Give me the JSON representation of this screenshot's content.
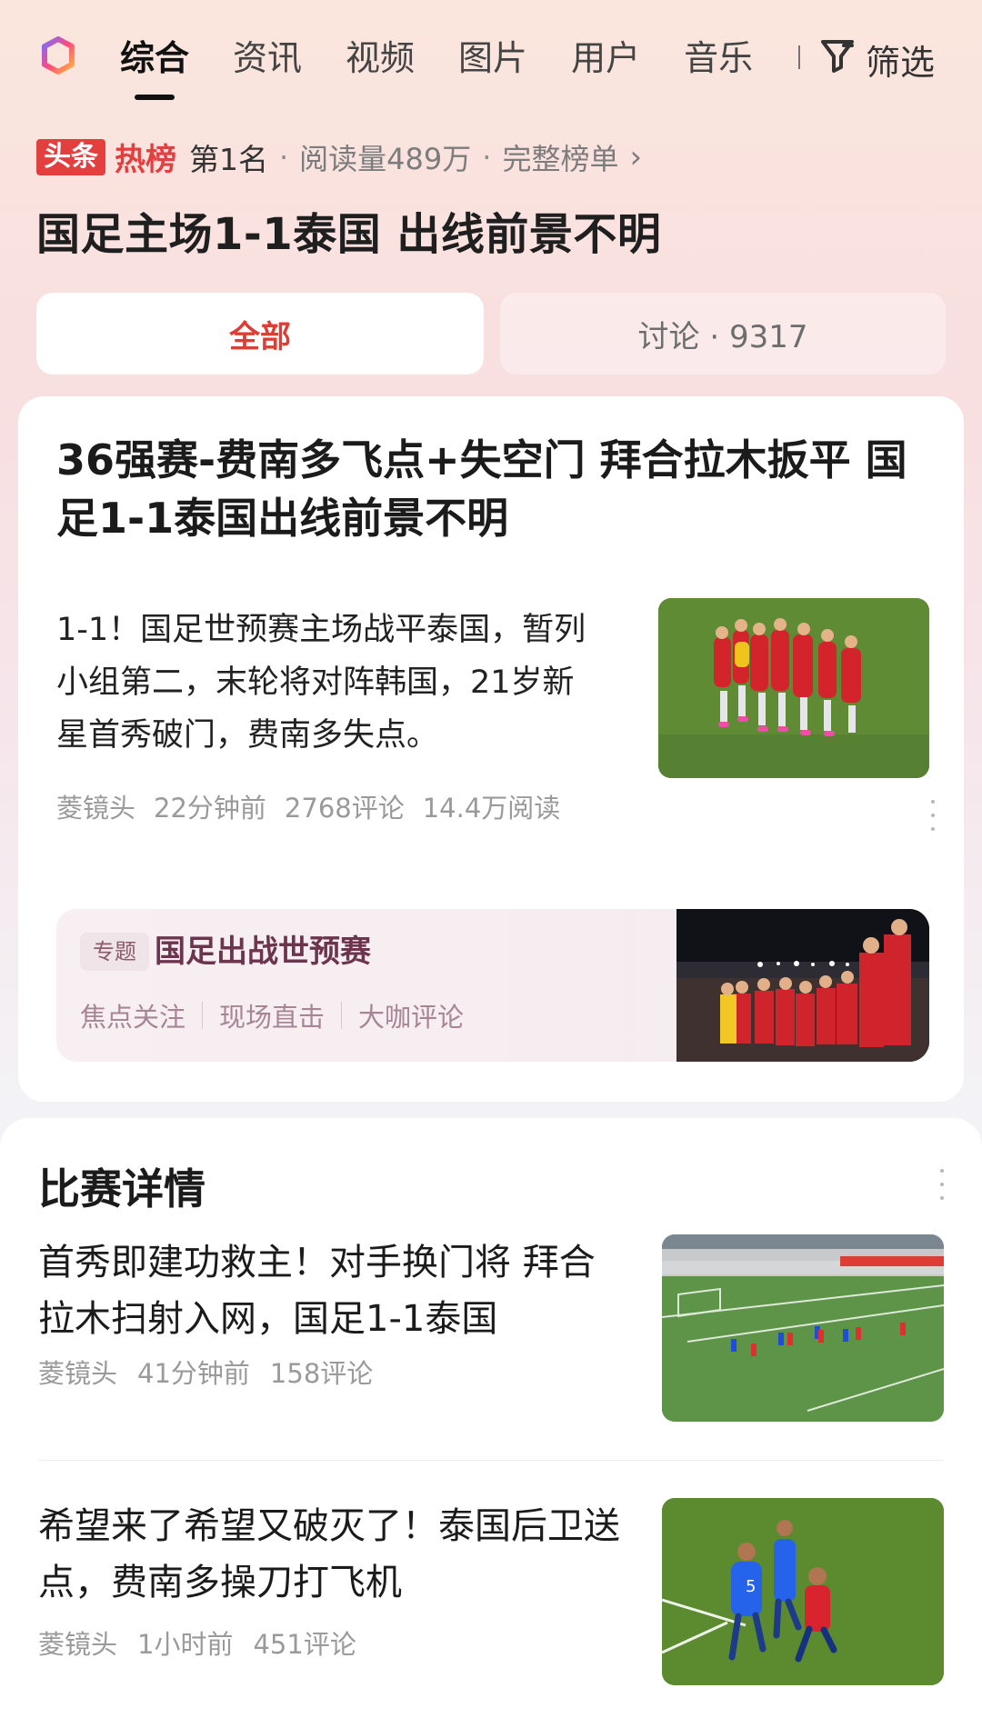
{
  "nav": {
    "tabs": [
      "综合",
      "资讯",
      "视频",
      "图片",
      "用户",
      "音乐"
    ],
    "filter_label": "筛选",
    "filter_icon": "filter-icon",
    "logo_icon": "app-logo-icon"
  },
  "hot": {
    "source_tag": "头条",
    "board_label": "热榜",
    "rank": "第1名",
    "reads": "阅读量489万",
    "full_list": "完整榜单",
    "chevron_icon": "chevron-right-icon"
  },
  "headline": "国足主场1-1泰国 出线前景不明",
  "segments": {
    "all": "全部",
    "discuss": "讨论 · 9317"
  },
  "main_card": {
    "title": "36强赛-费南多飞点+失空门 拜合拉木扳平 国足1-1泰国出线前景不明",
    "summary": "1-1！国足世预赛主场战平泰国，暂列小组第二，末轮将对阵韩国，21岁新星首秀破门，费南多失点。",
    "meta": [
      "菱镜头",
      "22分钟前",
      "2768评论",
      "14.4万阅读"
    ],
    "menu_icon": "more-vertical-icon",
    "topic": {
      "tag": "专题",
      "title": "国足出战世预赛",
      "links": [
        "焦点关注",
        "现场直击",
        "大咖评论"
      ]
    }
  },
  "details": {
    "title": "比赛详情",
    "menu_icon": "more-vertical-icon",
    "items": [
      {
        "title": "首秀即建功救主！对手换门将 拜合拉木扫射入网，国足1-1泰国",
        "meta": [
          "菱镜头",
          "41分钟前",
          "158评论"
        ],
        "image_icon": "soccer-broadcast-image"
      },
      {
        "title": "希望来了希望又破灭了！泰国后卫送点，费南多操刀打飞机",
        "meta": [
          "菱镜头",
          "1小时前",
          "451评论"
        ],
        "image_icon": "soccer-closeup-image"
      }
    ]
  },
  "colors": {
    "accent_red": "#df3c34",
    "tag_red": "#e33f3f",
    "topic_text": "#6d344d"
  }
}
